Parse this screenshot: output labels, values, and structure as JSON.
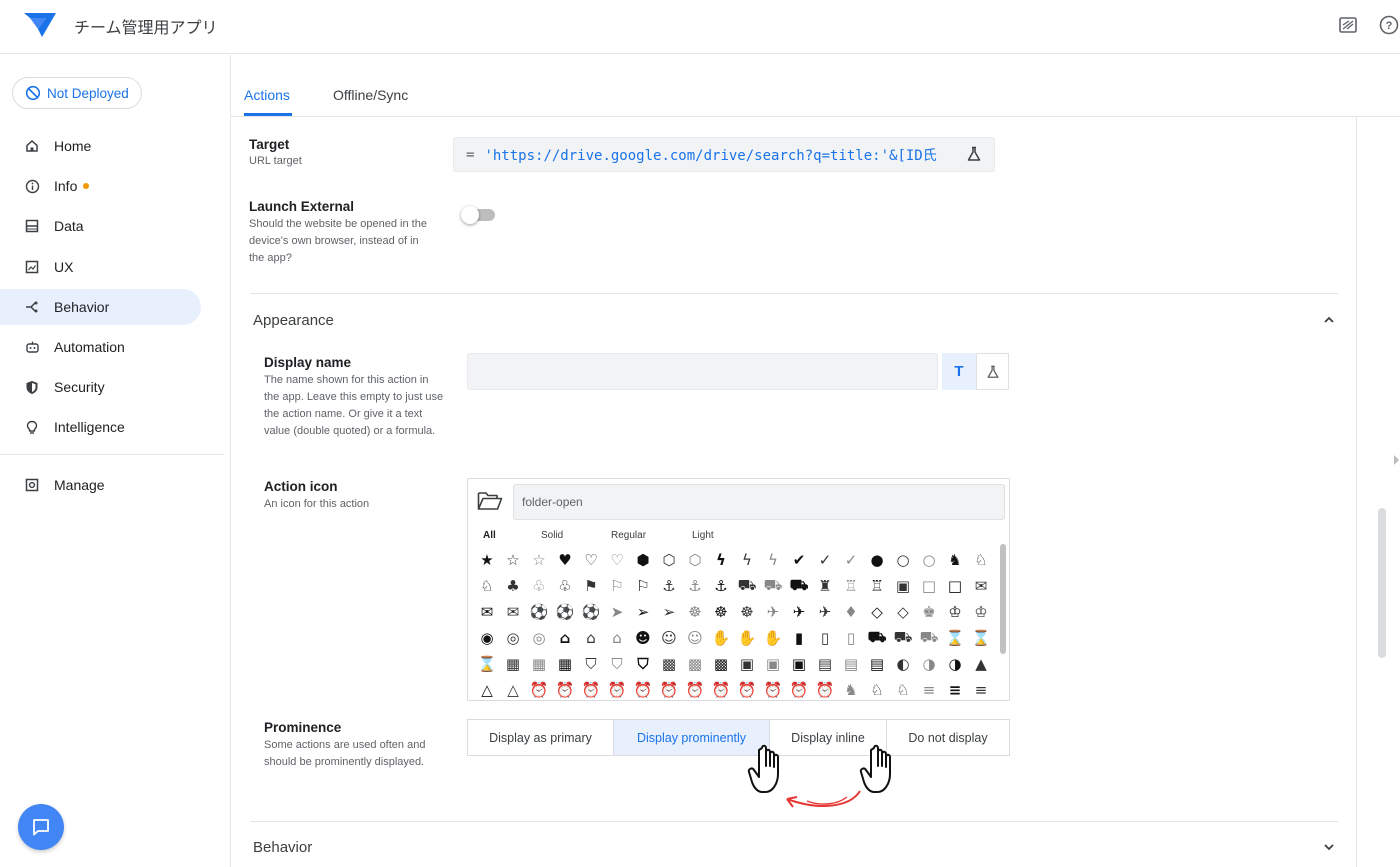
{
  "header": {
    "app_title": "チーム管理用アプリ",
    "icons": [
      "preview-icon",
      "help-icon"
    ]
  },
  "sidebar": {
    "deploy_status": "Not Deployed",
    "items": [
      {
        "label": "Home",
        "icon": "home-icon"
      },
      {
        "label": "Info",
        "icon": "info-icon",
        "badge": "dot"
      },
      {
        "label": "Data",
        "icon": "data-icon"
      },
      {
        "label": "UX",
        "icon": "ux-icon"
      },
      {
        "label": "Behavior",
        "icon": "behavior-icon",
        "active": true
      },
      {
        "label": "Automation",
        "icon": "automation-icon"
      },
      {
        "label": "Security",
        "icon": "shield-icon"
      },
      {
        "label": "Intelligence",
        "icon": "lightbulb-icon"
      },
      {
        "label": "Manage",
        "icon": "manage-icon"
      }
    ]
  },
  "tabs": [
    {
      "label": "Actions",
      "active": true
    },
    {
      "label": "Offline/Sync",
      "active": false
    }
  ],
  "target": {
    "label": "Target",
    "sublabel": "URL target",
    "formula_prefix": "=",
    "formula": "'https://drive.google.com/drive/search?q=title:'&[ID氏"
  },
  "launch_external": {
    "label": "Launch External",
    "description": "Should the website be opened in the device's own browser, instead of in the app?",
    "value": false
  },
  "appearance": {
    "title": "Appearance",
    "display_name": {
      "label": "Display name",
      "description": "The name shown for this action in the app. Leave this empty to just use the action name. Or give it a text value (double quoted) or a formula.",
      "value": "",
      "text_button": "T"
    },
    "action_icon": {
      "label": "Action icon",
      "description": "An icon for this action",
      "search_value": "folder-open",
      "filters": [
        "All",
        "Solid",
        "Regular",
        "Light"
      ],
      "active_filter": "All"
    },
    "prominence": {
      "label": "Prominence",
      "description": "Some actions are used often and should be prominently displayed.",
      "options": [
        "Display as primary",
        "Display prominently",
        "Display inline",
        "Do not display"
      ],
      "selected": "Display prominently"
    }
  },
  "behavior_section": {
    "title": "Behavior"
  },
  "colors": {
    "accent": "#1a73e8",
    "active_bg": "#e8f0fe",
    "badge": "#f29900",
    "arrow": "#e53935"
  }
}
